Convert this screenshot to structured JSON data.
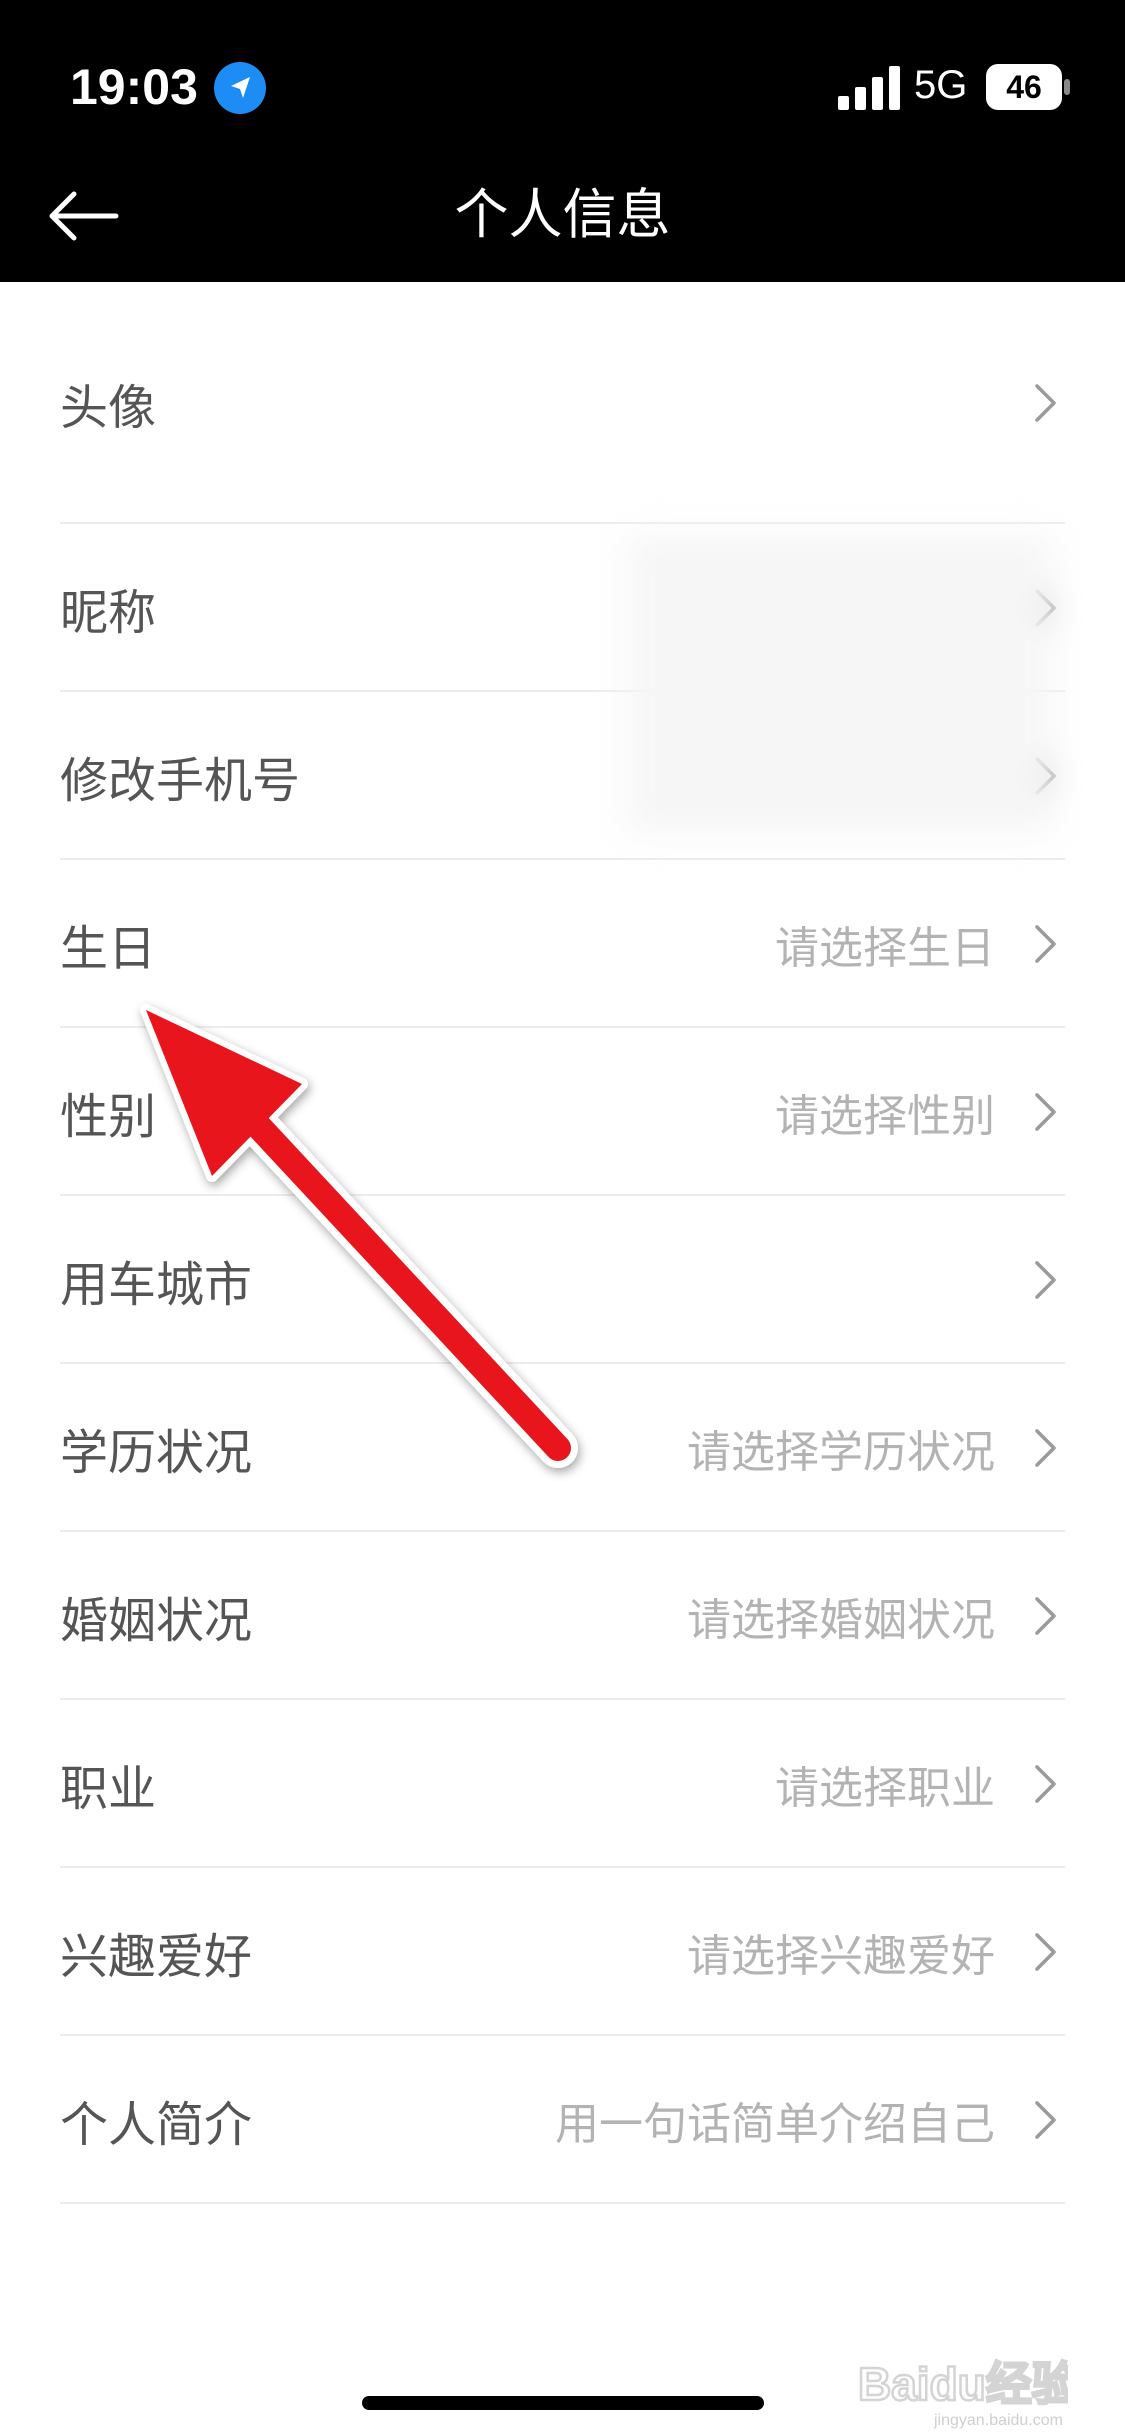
{
  "status_bar": {
    "time": "19:03",
    "network": "5G",
    "battery": "46"
  },
  "nav": {
    "title": "个人信息",
    "back_icon": "back-arrow-icon"
  },
  "rows": [
    {
      "label": "头像",
      "value": ""
    },
    {
      "label": "昵称",
      "value": ""
    },
    {
      "label": "修改手机号",
      "value": ""
    },
    {
      "label": "生日",
      "value": "请选择生日"
    },
    {
      "label": "性别",
      "value": "请选择性别"
    },
    {
      "label": "用车城市",
      "value": ""
    },
    {
      "label": "学历状况",
      "value": "请选择学历状况"
    },
    {
      "label": "婚姻状况",
      "value": "请选择婚姻状况"
    },
    {
      "label": "职业",
      "value": "请选择职业"
    },
    {
      "label": "兴趣爱好",
      "value": "请选择兴趣爱好"
    },
    {
      "label": "个人简介",
      "value": "用一句话简单介绍自己"
    }
  ],
  "watermark": {
    "brand": "Baidu经验",
    "url": "jingyan.baidu.com"
  },
  "colors": {
    "annotation_arrow": "#e8131c",
    "header_bg": "#000000",
    "location_icon": "#1d8cf5"
  }
}
